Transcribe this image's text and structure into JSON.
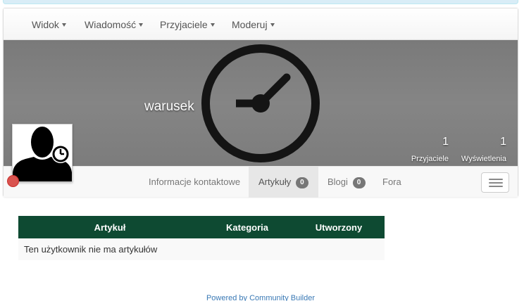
{
  "menu": {
    "items": [
      {
        "label": "Widok"
      },
      {
        "label": "Wiadomość"
      },
      {
        "label": "Przyjaciele"
      },
      {
        "label": "Moderuj"
      }
    ]
  },
  "profile": {
    "username": "warusek",
    "cover_icon": "clock-icon",
    "avatar_icon": "user-clock-silhouette-icon",
    "status_color": "#d9534f",
    "stats": [
      {
        "value": "1",
        "label": "Przyjaciele"
      },
      {
        "value": "1",
        "label": "Wyświetlenia"
      }
    ]
  },
  "tabs": [
    {
      "label": "Informacje kontaktowe"
    },
    {
      "label": "Artykuły",
      "badge": "0",
      "active": true
    },
    {
      "label": "Blogi",
      "badge": "0"
    },
    {
      "label": "Fora"
    }
  ],
  "articles_table": {
    "columns": [
      "Artykuł",
      "Kategoria",
      "Utworzony"
    ],
    "empty_message": "Ten użytkownik nie ma artykułów",
    "header_color": "#0e4a32"
  },
  "footer": {
    "powered_by": "Powered by Community Builder"
  }
}
